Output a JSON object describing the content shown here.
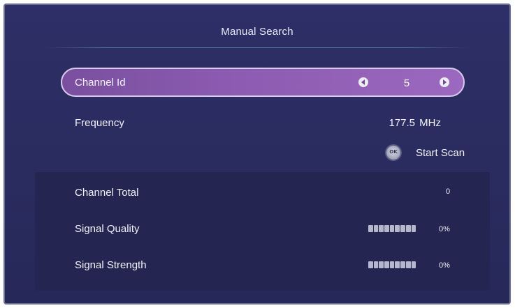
{
  "dialog": {
    "title": "Manual Search"
  },
  "channel_id": {
    "label": "Channel Id",
    "value": "5",
    "left_arrow_icon": "left-arrow-icon",
    "right_arrow_icon": "right-arrow-icon"
  },
  "frequency": {
    "label": "Frequency",
    "value": "177.5  MHz"
  },
  "start_scan": {
    "icon": "ok-button-icon",
    "icon_text": "OK",
    "label": "Start Scan"
  },
  "info": {
    "channel_total": {
      "label": "Channel Total",
      "value": "0"
    },
    "signal_quality": {
      "label": "Signal Quality",
      "value": "0%",
      "level": 0
    },
    "signal_strength": {
      "label": "Signal Strength",
      "value": "0%",
      "level": 0
    }
  },
  "colors": {
    "background": "#2d2f66",
    "highlight": "#8a5bb0",
    "panel": "#242551"
  }
}
